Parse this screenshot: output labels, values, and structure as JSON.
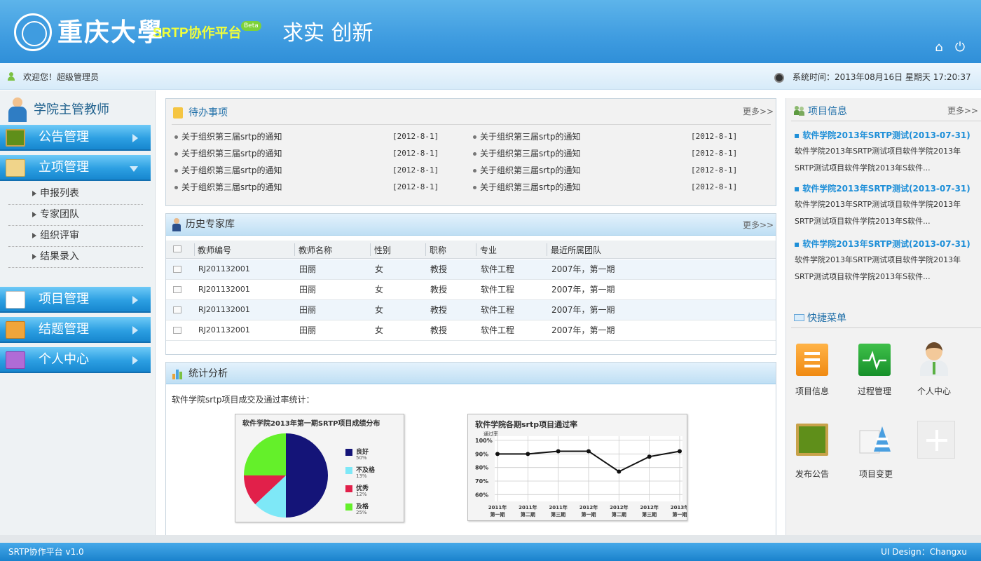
{
  "header": {
    "logo_name": "重庆大學",
    "platform": "SRTP协作平台",
    "beta": "Beta",
    "slogan": "求实 创新"
  },
  "userbar": {
    "welcome": "欢迎您！超级管理员",
    "systime": "系统时间：2013年08月16日 星期天 17:20:37"
  },
  "sidebar": {
    "title": "学院主管教师",
    "menus": [
      {
        "label": "公告管理"
      },
      {
        "label": "立项管理"
      },
      {
        "label": "项目管理"
      },
      {
        "label": "结题管理"
      },
      {
        "label": "个人中心"
      }
    ],
    "submenu": [
      {
        "label": "申报列表"
      },
      {
        "label": "专家团队"
      },
      {
        "label": "组织评审"
      },
      {
        "label": "结果录入"
      }
    ]
  },
  "todo": {
    "title": "待办事项",
    "more": "更多>>",
    "items": [
      {
        "text": "关于组织第三届srtp的通知",
        "date": "[2012-8-1]"
      },
      {
        "text": "关于组织第三届srtp的通知",
        "date": "[2012-8-1]"
      },
      {
        "text": "关于组织第三届srtp的通知",
        "date": "[2012-8-1]"
      },
      {
        "text": "关于组织第三届srtp的通知",
        "date": "[2012-8-1]"
      },
      {
        "text": "关于组织第三届srtp的通知",
        "date": "[2012-8-1]"
      },
      {
        "text": "关于组织第三届srtp的通知",
        "date": "[2012-8-1]"
      },
      {
        "text": "关于组织第三届srtp的通知",
        "date": "[2012-8-1]"
      },
      {
        "text": "关于组织第三届srtp的通知",
        "date": "[2012-8-1]"
      }
    ]
  },
  "experts": {
    "title": "历史专家库",
    "more": "更多>>",
    "columns": [
      "教师编号",
      "教师名称",
      "性别",
      "职称",
      "专业",
      "最近所属团队"
    ],
    "rows": [
      [
        "RJ201132001",
        "田丽",
        "女",
        "教授",
        "软件工程",
        "2007年，第一期"
      ],
      [
        "RJ201132001",
        "田丽",
        "女",
        "教授",
        "软件工程",
        "2007年，第一期"
      ],
      [
        "RJ201132001",
        "田丽",
        "女",
        "教授",
        "软件工程",
        "2007年，第一期"
      ],
      [
        "RJ201132001",
        "田丽",
        "女",
        "教授",
        "软件工程",
        "2007年，第一期"
      ]
    ]
  },
  "stats": {
    "title": "统计分析",
    "subtitle": "软件学院srtp项目成交及通过率统计："
  },
  "chart_data": [
    {
      "type": "pie",
      "title": "软件学院2013年第一期SRTP项目成绩分布",
      "categories": [
        "良好",
        "不及格",
        "优秀",
        "及格"
      ],
      "values": [
        50,
        13,
        12,
        25
      ],
      "labels": [
        "50%",
        "13%",
        "12%",
        "25%"
      ],
      "colors": [
        "#141478",
        "#7ee8f7",
        "#e1204a",
        "#64f02a"
      ],
      "legend": "right"
    },
    {
      "type": "line",
      "title": "软件学院各期srtp项目通过率",
      "ylabel": "通过率",
      "x": [
        "2011年第一期",
        "2011年第二期",
        "2011年第三期",
        "2012年第一期",
        "2012年第二期",
        "2012年第三期",
        "2013年第一期"
      ],
      "x_top": [
        "2011年",
        "2011年",
        "2011年",
        "2012年",
        "2012年",
        "2012年",
        "2013年"
      ],
      "x_bottom": [
        "第一期",
        "第二期",
        "第三期",
        "第一期",
        "第二期",
        "第三期",
        "第一期"
      ],
      "values": [
        90,
        90,
        92,
        92,
        77,
        88,
        92
      ],
      "yticks": [
        "100%",
        "90%",
        "80%",
        "70%",
        "60%"
      ],
      "ylim": [
        55,
        100
      ],
      "grid": true
    }
  ],
  "right": {
    "proj_title": "项目信息",
    "more": "更多>>",
    "projects": [
      {
        "title": "▪ 软件学院2013年SRTP测试(2013-07-31)",
        "line1": "软件学院2013年SRTP测试项目软件学院2013年",
        "line2": "SRTP测试项目软件学院2013年S软件..."
      },
      {
        "title": "▪ 软件学院2013年SRTP测试(2013-07-31)",
        "line1": "软件学院2013年SRTP测试项目软件学院2013年",
        "line2": "SRTP测试项目软件学院2013年S软件..."
      },
      {
        "title": "▪ 软件学院2013年SRTP测试(2013-07-31)",
        "line1": "软件学院2013年SRTP测试项目软件学院2013年",
        "line2": "SRTP测试项目软件学院2013年S软件..."
      }
    ],
    "quick_title": "快捷菜单",
    "quick": [
      {
        "label": "项目信息"
      },
      {
        "label": "过程管理"
      },
      {
        "label": "个人中心"
      },
      {
        "label": "发布公告"
      },
      {
        "label": "项目变更"
      }
    ]
  },
  "footer": {
    "left": "SRTP协作平台 v1.0",
    "right": "UI Design：Changxu"
  }
}
